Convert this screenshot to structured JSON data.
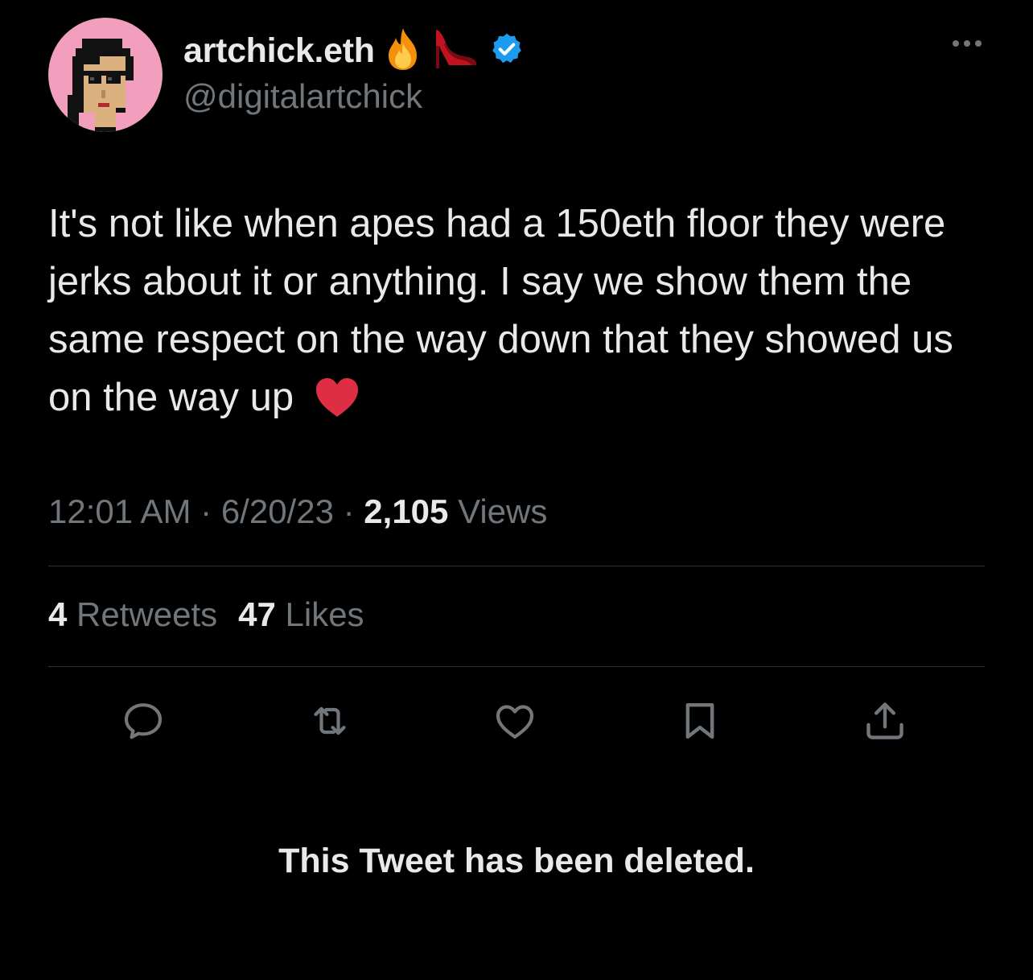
{
  "author": {
    "display_name": "artchick.eth",
    "handle": "@digitalartchick",
    "name_emojis": [
      "fire-emoji",
      "high-heel-emoji"
    ],
    "verified": true
  },
  "tweet": {
    "text": "It's not like when apes had a 150eth floor they were jerks about it or anything.  I say we show them the same respect on the way down that they showed us on the way up",
    "trailing_emoji": "red-heart-emoji",
    "time": "12:01 AM",
    "date": "6/20/23",
    "separator": "·",
    "views_count": "2,105",
    "views_label": "Views"
  },
  "stats": {
    "retweets_count": "4",
    "retweets_label": "Retweets",
    "likes_count": "47",
    "likes_label": "Likes"
  },
  "actions": [
    "reply-icon",
    "retweet-icon",
    "like-icon",
    "bookmark-icon",
    "share-icon"
  ],
  "notice": {
    "deleted_text": "This Tweet has been deleted."
  },
  "colors": {
    "background": "#000000",
    "primary_text": "#e7e9ea",
    "secondary_text": "#71767b",
    "divider": "#2f3336",
    "verified_blue": "#1d9bf0",
    "avatar_bg": "#f19fbd"
  }
}
